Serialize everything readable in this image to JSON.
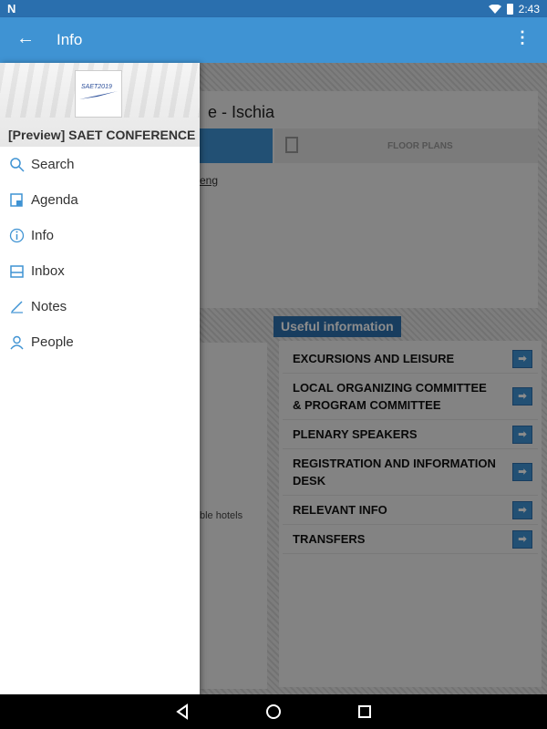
{
  "status_bar": {
    "time": "2:43",
    "left_icon": "N"
  },
  "app_bar": {
    "title": "Info",
    "back_icon": "←",
    "more_icon": "⋮"
  },
  "background": {
    "heading_fragment": "e - Ischia",
    "floor_plans_tab": "FLOOR PLANS",
    "link_fragment": "eng",
    "useful_title": "Useful information",
    "useful_items": [
      "EXCURSIONS AND LEISURE",
      "LOCAL ORGANIZING COMMITTEE & PROGRAM COMMITTEE",
      "PLENARY SPEAKERS",
      "REGISTRATION AND INFORMATION DESK",
      "RELEVANT INFO",
      "TRANSFERS"
    ],
    "hotels_fragment": "ble hotels"
  },
  "drawer": {
    "logo_text": "SAET2019",
    "title": "[Preview] SAET CONFERENCE",
    "items": [
      {
        "label": "Search",
        "icon": "search-icon"
      },
      {
        "label": "Agenda",
        "icon": "agenda-icon"
      },
      {
        "label": "Info",
        "icon": "info-icon"
      },
      {
        "label": "Inbox",
        "icon": "inbox-icon"
      },
      {
        "label": "Notes",
        "icon": "notes-icon"
      },
      {
        "label": "People",
        "icon": "people-icon"
      }
    ]
  },
  "colors": {
    "primary": "#3f93d3",
    "status_bar": "#2a6fae",
    "accent_dark": "#2c6fad"
  }
}
